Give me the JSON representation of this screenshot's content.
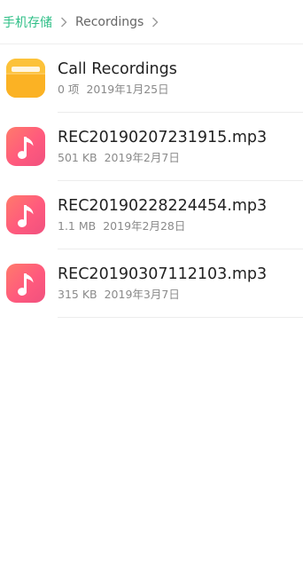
{
  "breadcrumb": {
    "root_label": "手机存储",
    "current_label": "Recordings"
  },
  "files": [
    {
      "type": "folder",
      "icon": "folder-icon",
      "name": "Call Recordings",
      "size": "0 项",
      "date": "2019年1月25日"
    },
    {
      "type": "audio",
      "icon": "music-note-icon",
      "name": "REC20190207231915.mp3",
      "size": "501 KB",
      "date": "2019年2月7日"
    },
    {
      "type": "audio",
      "icon": "music-note-icon",
      "name": "REC20190228224454.mp3",
      "size": "1.1 MB",
      "date": "2019年2月28日"
    },
    {
      "type": "audio",
      "icon": "music-note-icon",
      "name": "REC20190307112103.mp3",
      "size": "315 KB",
      "date": "2019年3月7日"
    }
  ],
  "colors": {
    "accent": "#2fbf87",
    "folder": "#fbb224",
    "audio": "#ff5a7d"
  }
}
